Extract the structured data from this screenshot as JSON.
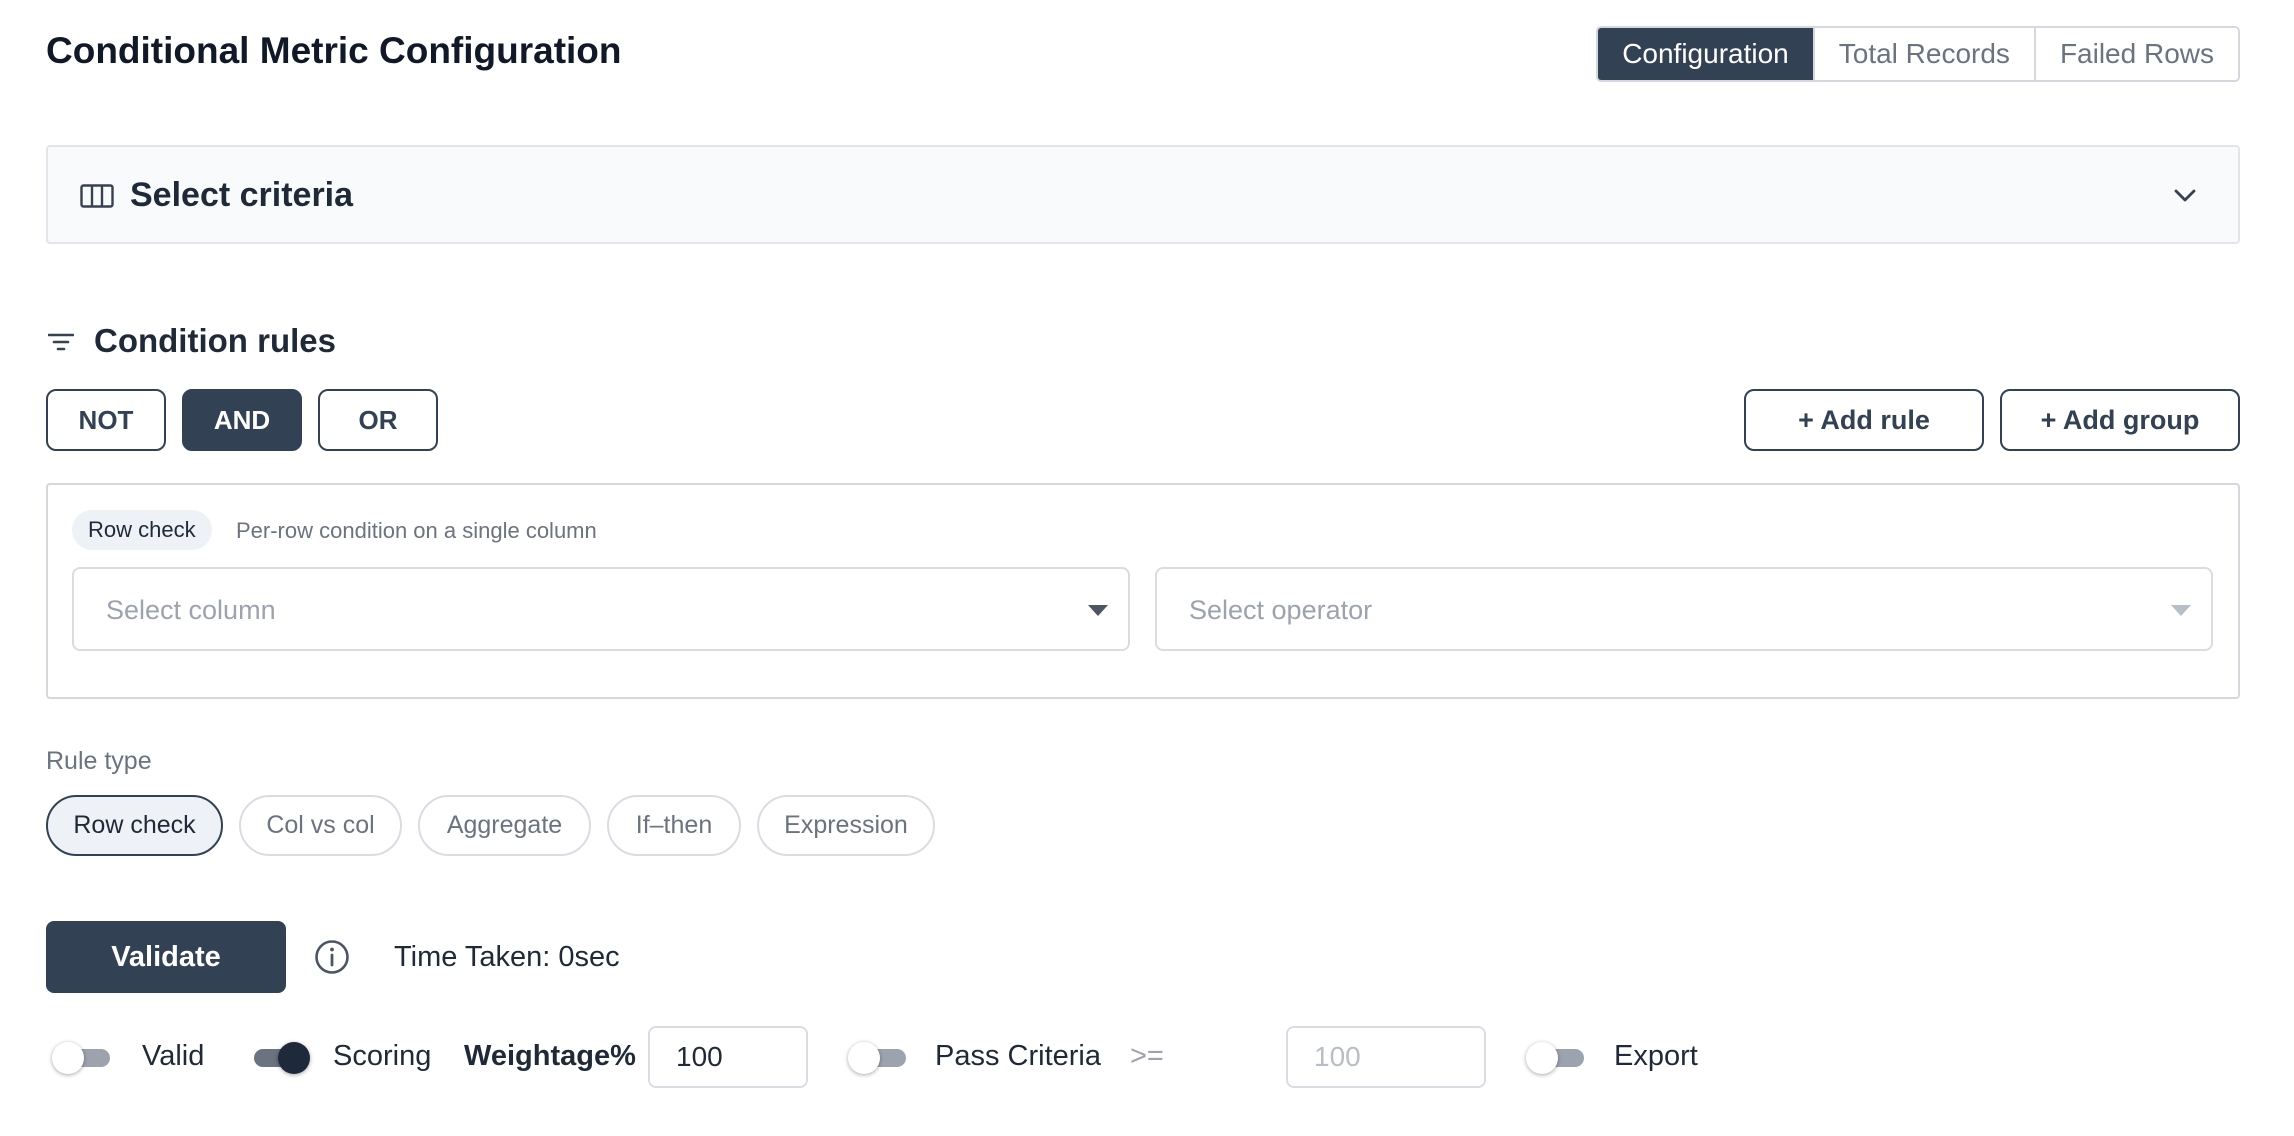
{
  "header": {
    "title": "Conditional Metric Configuration",
    "tabs": [
      {
        "label": "Configuration",
        "active": true
      },
      {
        "label": "Total Records",
        "active": false
      },
      {
        "label": "Failed Rows",
        "active": false
      }
    ]
  },
  "criteria": {
    "icon": "columns-icon",
    "title": "Select criteria",
    "toggle_icon": "chevron-down-icon"
  },
  "conditions": {
    "icon": "filter-icon",
    "title": "Condition rules",
    "logic_buttons": [
      {
        "label": "NOT",
        "active": false
      },
      {
        "label": "AND",
        "active": true
      },
      {
        "label": "OR",
        "active": false
      }
    ],
    "add_rule_label": "+ Add rule",
    "add_group_label": "+ Add group"
  },
  "rule": {
    "badge": "Row check",
    "description": "Per-row condition on a single column",
    "column_placeholder": "Select column",
    "operator_placeholder": "Select operator"
  },
  "rule_type": {
    "label": "Rule type",
    "options": [
      {
        "label": "Row check",
        "active": true
      },
      {
        "label": "Col vs col",
        "active": false
      },
      {
        "label": "Aggregate",
        "active": false
      },
      {
        "label": "If–then",
        "active": false
      },
      {
        "label": "Expression",
        "active": false
      }
    ]
  },
  "actions": {
    "validate_label": "Validate",
    "info_icon": "info-icon",
    "time_taken": "Time Taken: 0sec"
  },
  "settings": {
    "valid": {
      "label": "Valid",
      "enabled": false
    },
    "scoring": {
      "label": "Scoring",
      "enabled": true
    },
    "weightage_label": "Weightage%",
    "weightage_value": "100",
    "pass_criteria": {
      "label": "Pass Criteria",
      "enabled": false
    },
    "operator": ">=",
    "pass_value_placeholder": "100",
    "export": {
      "label": "Export",
      "enabled": false
    }
  },
  "colors": {
    "primary": "#334155",
    "border": "#d4d8de",
    "muted_text": "#6b7280",
    "panel_bg": "#f8fafc"
  }
}
